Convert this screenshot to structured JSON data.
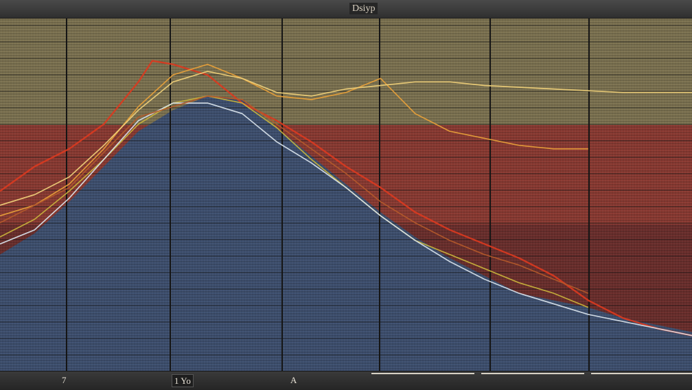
{
  "header": {
    "label": "Dsiyp"
  },
  "chart_data": {
    "type": "line",
    "title": "",
    "xlabel": "",
    "ylabel": "",
    "x_tick_labels": [
      "7",
      "1 Yo",
      "A"
    ],
    "xlim": [
      0,
      100
    ],
    "ylim": [
      0,
      100
    ],
    "grid": true,
    "colors": {
      "area_fill": "#3e5070",
      "band_top": "#7d7351",
      "band_mid": "#8b3a32",
      "band_low": "#6b2e2c"
    },
    "area": {
      "x": [
        0,
        5,
        10,
        15,
        20,
        25,
        30,
        35,
        40,
        45,
        50,
        55,
        60,
        65,
        70,
        75,
        80,
        85,
        90,
        95,
        100
      ],
      "y": [
        33,
        39,
        48,
        58,
        68,
        74,
        78,
        77,
        69,
        61,
        53,
        45,
        38,
        32,
        27,
        22,
        20,
        18,
        15,
        13,
        11
      ]
    },
    "series": [
      {
        "color": "#d93a20",
        "x": [
          0,
          5,
          10,
          15,
          20,
          22,
          25,
          30,
          35,
          40,
          45,
          50,
          55,
          60,
          65,
          70,
          75,
          80,
          85,
          90,
          95,
          100
        ],
        "y": [
          51,
          58,
          63,
          70,
          82,
          88,
          87,
          84,
          76,
          71,
          65,
          58,
          52,
          45,
          40,
          36,
          32,
          27,
          20,
          15,
          12,
          10
        ]
      },
      {
        "color": "#e8a13a",
        "x": [
          0,
          5,
          10,
          15,
          20,
          25,
          30,
          35,
          40,
          45,
          50,
          55,
          60,
          65,
          70,
          75,
          80,
          85
        ],
        "y": [
          44,
          47,
          53,
          63,
          75,
          84,
          87,
          83,
          78,
          77,
          79,
          83,
          73,
          68,
          66,
          64,
          63,
          63
        ]
      },
      {
        "color": "#f0d07a",
        "x": [
          0,
          5,
          10,
          15,
          20,
          25,
          30,
          35,
          40,
          45,
          50,
          55,
          60,
          65,
          70,
          80,
          90,
          100
        ],
        "y": [
          47,
          50,
          55,
          64,
          74,
          82,
          85,
          83,
          79,
          78,
          80,
          81,
          82,
          82,
          81,
          80,
          79,
          79
        ]
      },
      {
        "color": "#c9b43c",
        "x": [
          0,
          5,
          10,
          15,
          20,
          25,
          30,
          35,
          40,
          45,
          50,
          55,
          60,
          65,
          70,
          75,
          80,
          85
        ],
        "y": [
          38,
          43,
          51,
          60,
          70,
          76,
          78,
          76,
          69,
          60,
          52,
          44,
          37,
          33,
          29,
          25,
          22,
          18
        ]
      },
      {
        "color": "#d8e2ea",
        "x": [
          0,
          5,
          10,
          15,
          20,
          25,
          30,
          35,
          40,
          45,
          50,
          55,
          60,
          65,
          70,
          75,
          80,
          85,
          90,
          95,
          100
        ],
        "y": [
          36,
          40,
          49,
          60,
          71,
          76,
          76,
          73,
          65,
          59,
          52,
          44,
          37,
          31,
          26,
          22,
          19,
          16,
          14,
          12,
          10
        ]
      },
      {
        "color": "#b45a2a",
        "x": [
          0,
          10,
          20,
          30,
          35,
          40,
          45,
          50,
          55,
          60,
          65,
          70,
          75,
          80,
          85
        ],
        "y": [
          42,
          52,
          72,
          78,
          77,
          70,
          63,
          56,
          48,
          42,
          37,
          33,
          30,
          26,
          22
        ]
      }
    ]
  }
}
